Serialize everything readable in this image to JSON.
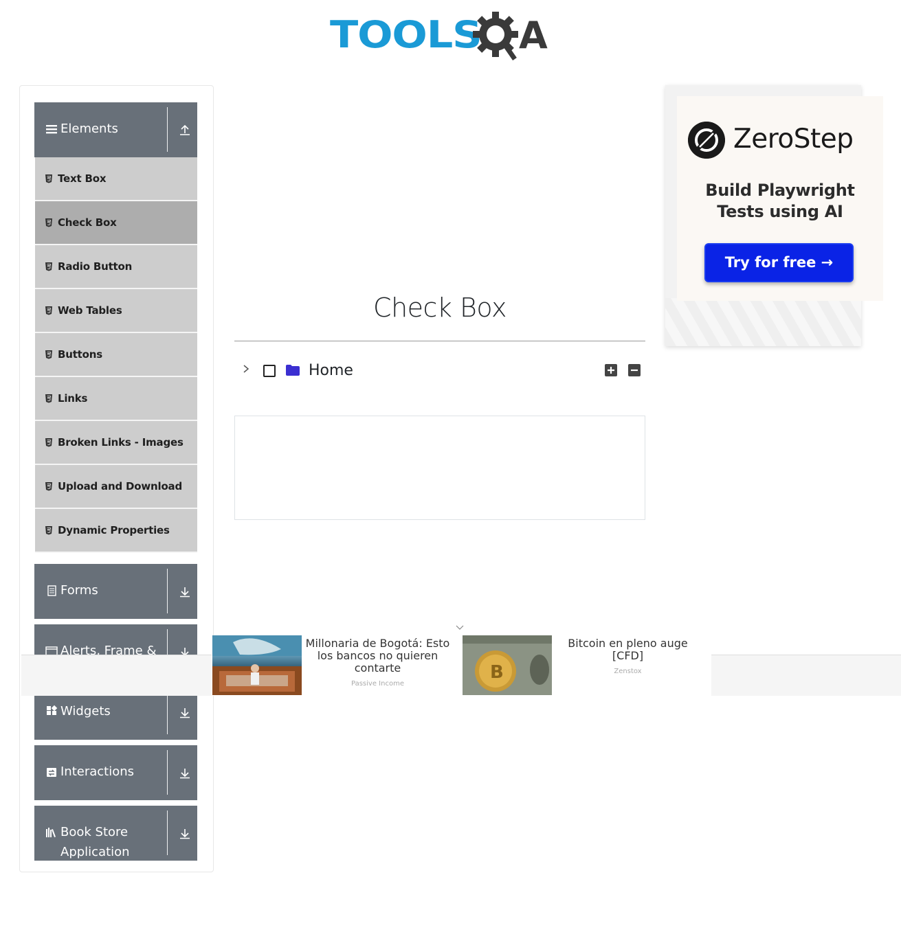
{
  "logo": {
    "text_tools": "TOOLS",
    "text_qa": "QA"
  },
  "sidebar": {
    "groups": [
      {
        "label": "Elements",
        "icon": "hamburger-icon",
        "toggle": "collapse-up-icon"
      },
      {
        "label": "Forms",
        "icon": "document-icon",
        "toggle": "expand-down-icon"
      },
      {
        "label": "Alerts, Frame & Windows",
        "icon": "window-icon",
        "toggle": "expand-down-icon"
      },
      {
        "label": "Widgets",
        "icon": "widgets-icon",
        "toggle": "expand-down-icon"
      },
      {
        "label": "Interactions",
        "icon": "swap-icon",
        "toggle": "expand-down-icon"
      },
      {
        "label": "Book Store Application",
        "icon": "books-icon",
        "toggle": "expand-down-icon"
      }
    ],
    "element_items": [
      {
        "label": "Text Box"
      },
      {
        "label": "Check Box",
        "active": true
      },
      {
        "label": "Radio Button"
      },
      {
        "label": "Web Tables"
      },
      {
        "label": "Buttons"
      },
      {
        "label": "Links"
      },
      {
        "label": "Broken Links - Images"
      },
      {
        "label": "Upload and Download"
      },
      {
        "label": "Dynamic Properties"
      }
    ]
  },
  "main": {
    "title": "Check Box",
    "tree": {
      "root_label": "Home",
      "checked": false,
      "expanded": false
    }
  },
  "ad_right": {
    "brand": "ZeroStep",
    "tagline": "Build Playwright Tests using AI",
    "cta": "Try for free →",
    "cta_color": "#0a23e6"
  },
  "ad_bottom": {
    "items": [
      {
        "headline": "Millonaria de Bogotá: Esto los bancos no quieren contarte",
        "source": "Passive Income"
      },
      {
        "headline": "Bitcoin en pleno auge [CFD]",
        "source": "Zenstox"
      }
    ]
  },
  "colors": {
    "group_header": "#687079",
    "menu_item": "#cdcdcd",
    "menu_active": "#adadad",
    "logo_blue": "#1a9ad6",
    "logo_dark": "#3a3a3a"
  }
}
